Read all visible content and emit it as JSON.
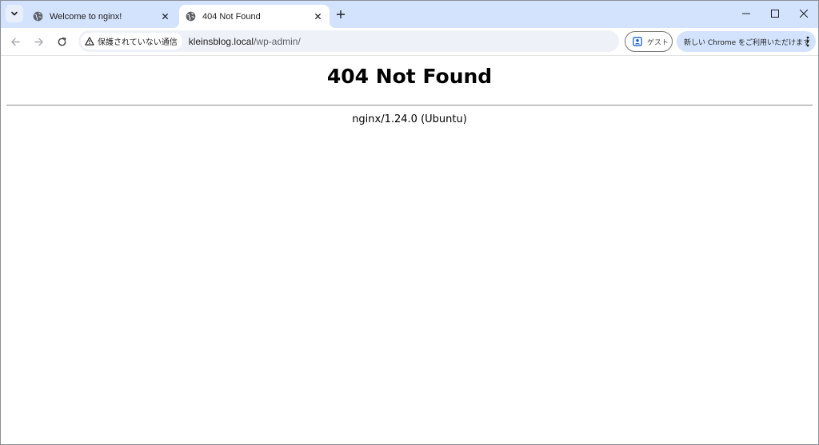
{
  "browser": {
    "tabs": [
      {
        "title": "Welcome to nginx!",
        "active": false,
        "icon": "globe-icon"
      },
      {
        "title": "404 Not Found",
        "active": true,
        "icon": "globe-icon"
      }
    ],
    "address_bar": {
      "security_label": "保護されていない通信",
      "security_icon": "warning-icon",
      "url_host": "kleinsblog.local",
      "url_path": "/wp-admin/"
    },
    "profile_label": "ゲスト",
    "promo_label": "新しい Chrome をご利用いただけます",
    "accent_color": "#d3e3fd"
  },
  "page": {
    "heading": "404 Not Found",
    "server_signature": "nginx/1.24.0 (Ubuntu)"
  }
}
